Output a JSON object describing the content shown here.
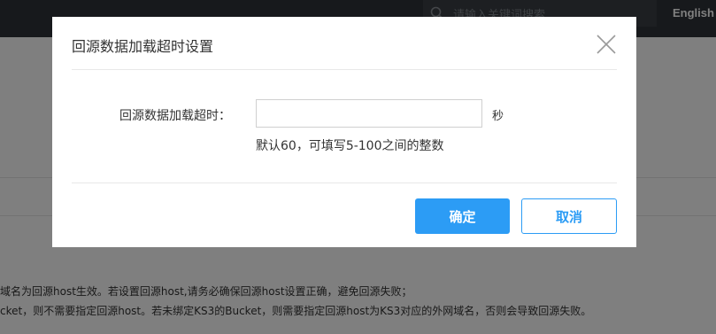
{
  "navbar": {
    "search_placeholder": "请输入关键词搜索",
    "language": "English"
  },
  "background": {
    "line1": "域名为回源host生效。若设置回源host,请务必确保回源host设置正确，避免回源失败；",
    "line2": "cket，则不需要指定回源host。若未绑定KS3的Bucket，则需要指定回源host为KS3对应的外网域名，否则会导致回源失败。"
  },
  "modal": {
    "title": "回源数据加载超时设置",
    "field_label": "回源数据加载超时：",
    "input_value": "",
    "unit": "秒",
    "hint": "默认60，可填写5-100之间的整数",
    "confirm_label": "确定",
    "cancel_label": "取消"
  },
  "colors": {
    "primary": "#2c9cf5",
    "navbar": "#2f3338",
    "overlay": "rgba(0,0,0,0.5)"
  }
}
